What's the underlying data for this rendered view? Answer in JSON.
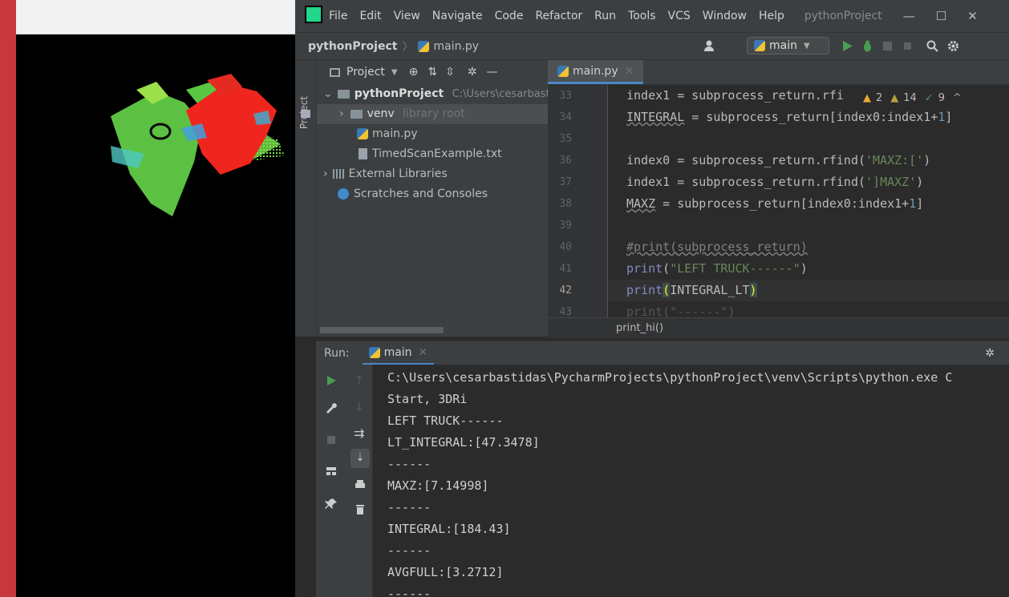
{
  "ide": {
    "menu": [
      "File",
      "Edit",
      "View",
      "Navigate",
      "Code",
      "Refactor",
      "Run",
      "Tools",
      "VCS",
      "Window",
      "Help"
    ],
    "project_title": "pythonProject",
    "window_controls": {
      "minimize": "—",
      "maximize": "☐",
      "close": "✕"
    }
  },
  "navbar": {
    "project": "pythonProject",
    "file": "main.py",
    "run_config": "main"
  },
  "stripe": {
    "label": "Project"
  },
  "project_panel": {
    "header": "Project",
    "tree": [
      {
        "label": "pythonProject",
        "hint": "C:\\Users\\cesarbastid"
      },
      {
        "label": "venv",
        "hint": "library root"
      },
      {
        "label": "main.py"
      },
      {
        "label": "TimedScanExample.txt"
      },
      {
        "label": "External Libraries"
      },
      {
        "label": "Scratches and Consoles"
      }
    ]
  },
  "editor": {
    "tab": "main.py",
    "line_numbers": [
      "33",
      "34",
      "35",
      "36",
      "37",
      "38",
      "39",
      "40",
      "41",
      "42",
      "43"
    ],
    "inspections": {
      "warn": "2",
      "weak": "14",
      "typo": "9"
    },
    "breadcrumb": "print_hi()",
    "code": {
      "l33_a": "index1 = subprocess_return.rfi",
      "l34_a": "INTEGRAL",
      "l34_b": " = subprocess_return[index0:index1+",
      "l34_c": "1",
      "l34_d": "]",
      "l36_a": "index0 = subprocess_return.rfind(",
      "l36_b": "'MAXZ:['",
      "l36_c": ")",
      "l37_a": "index1 = subprocess_return.rfind(",
      "l37_b": "']MAXZ'",
      "l37_c": ")",
      "l38_a": "MAXZ",
      "l38_b": " = subprocess_return[index0:index1+",
      "l38_c": "1",
      "l38_d": "]",
      "l40": "#print(subprocess_return)",
      "l41_a": "print",
      "l41_b": "(",
      "l41_c": "\"LEFT TRUCK------\"",
      "l41_d": ")",
      "l42_a": "print",
      "l42_b": "(",
      "l42_c": "INTEGRAL_LT",
      "l42_d": ")",
      "l43": "print(\"------\")"
    }
  },
  "run": {
    "label": "Run:",
    "tab": "main",
    "output": [
      "C:\\Users\\cesarbastidas\\PycharmProjects\\pythonProject\\venv\\Scripts\\python.exe C",
      "Start, 3DRi",
      "LEFT TRUCK------",
      "LT_INTEGRAL:[47.3478]",
      "------",
      "MAXZ:[7.14998]",
      "------",
      "INTEGRAL:[184.43]",
      "------",
      "AVGFULL:[3.2712]",
      "------"
    ]
  },
  "colors": {
    "accent": "#4a88c7",
    "run_green": "#499c54",
    "warning": "#f0a732"
  }
}
